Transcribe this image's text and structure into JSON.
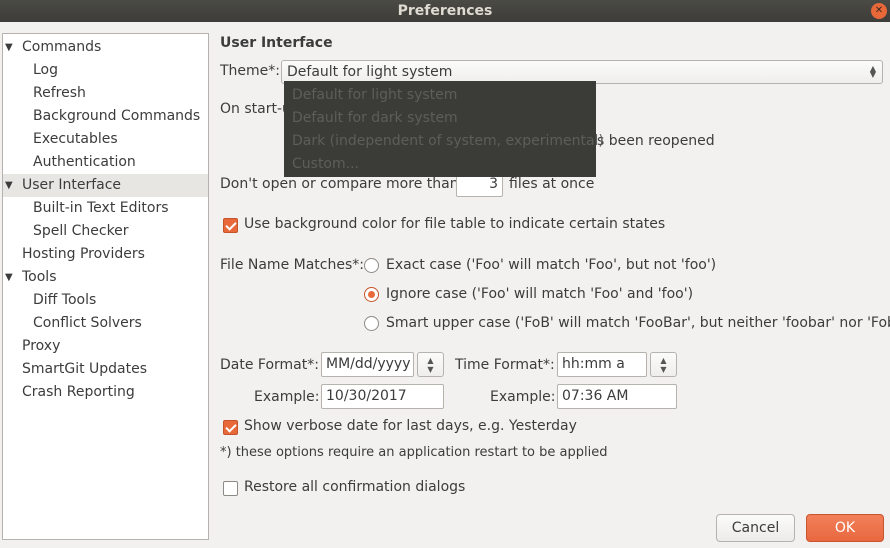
{
  "window": {
    "title": "Preferences"
  },
  "sidebar": {
    "items": [
      {
        "label": "Commands",
        "level": 0,
        "expanded": true
      },
      {
        "label": "Log",
        "level": 1
      },
      {
        "label": "Refresh",
        "level": 1
      },
      {
        "label": "Background Commands",
        "level": 1
      },
      {
        "label": "Executables",
        "level": 1
      },
      {
        "label": "Authentication",
        "level": 1
      },
      {
        "label": "User Interface",
        "level": 0,
        "expanded": true,
        "selected": true
      },
      {
        "label": "Built-in Text Editors",
        "level": 1
      },
      {
        "label": "Spell Checker",
        "level": 1
      },
      {
        "label": "Hosting Providers",
        "level": 0
      },
      {
        "label": "Tools",
        "level": 0,
        "expanded": true
      },
      {
        "label": "Diff Tools",
        "level": 1
      },
      {
        "label": "Conflict Solvers",
        "level": 1
      },
      {
        "label": "Proxy",
        "level": 0
      },
      {
        "label": "SmartGit Updates",
        "level": 0
      },
      {
        "label": "Crash Reporting",
        "level": 0
      }
    ]
  },
  "main": {
    "section_title": "User Interface",
    "theme": {
      "label": "Theme*:",
      "selected": "Default for light system",
      "options": [
        "Default for light system",
        "Default for dark system",
        "Dark (independent of system, experimental)",
        "Custom..."
      ]
    },
    "startup": {
      "label_visible": "On start-u",
      "text_visible": "s been reopened"
    },
    "max_files": {
      "prefix": "Don't open or compare more than:",
      "value": "3",
      "suffix": "files at once"
    },
    "bg_color_checkbox": {
      "label": "Use background color for file table to indicate certain states",
      "checked": true
    },
    "file_name_matches": {
      "label": "File Name Matches*:",
      "options": [
        {
          "label": "Exact case ('Foo' will match 'Foo', but not 'foo')",
          "selected": false
        },
        {
          "label": "Ignore case ('Foo' will match 'Foo' and 'foo')",
          "selected": true
        },
        {
          "label": "Smart upper case ('FoB' will match 'FooBar', but neither 'foobar' nor 'Fob')",
          "selected": false
        }
      ]
    },
    "date_format": {
      "label": "Date Format*:",
      "value": "MM/dd/yyyy",
      "example_label": "Example:",
      "example_value": "10/30/2017"
    },
    "time_format": {
      "label": "Time Format*:",
      "value": "hh:mm a",
      "example_label": "Example:",
      "example_value": "07:36 AM"
    },
    "verbose_checkbox": {
      "label": "Show verbose date for last days, e.g. Yesterday",
      "checked": true
    },
    "restart_note": "*) these options require an application restart to be applied",
    "restore_checkbox": {
      "label": "Restore all confirmation dialogs",
      "checked": false
    }
  },
  "footer": {
    "cancel_label": "Cancel",
    "ok_label": "OK"
  },
  "colors": {
    "accent": "#e9683a",
    "titlebar": "#3d3c38",
    "dropdown_bg": "#3b3b38"
  }
}
